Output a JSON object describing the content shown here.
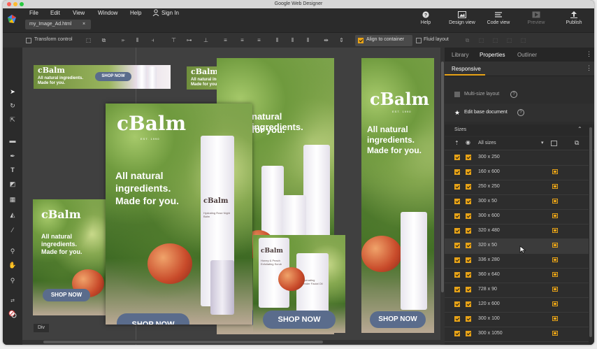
{
  "window": {
    "title": "Google Web Designer"
  },
  "menu": {
    "items": [
      "File",
      "Edit",
      "View",
      "Window",
      "Help"
    ],
    "sign_in": "Sign In"
  },
  "file_tab": {
    "name": "my_Image_Ad.html",
    "close": "×"
  },
  "top_buttons": {
    "help": "Help",
    "design_view": "Design view",
    "code_view": "Code view",
    "preview": "Preview",
    "publish": "Publish"
  },
  "toolbar": {
    "transform_control": "Transform control",
    "align_to_container": "Align to container",
    "fluid_layout": "Fluid layout"
  },
  "stage": {
    "element_label": "Div"
  },
  "ad": {
    "brand": "cBalm",
    "est": "EST. 1990",
    "tagline_lines": [
      "All natural",
      "ingredients.",
      "Made for you."
    ],
    "tagline_natural": "natural ingredients.",
    "tagline_foryou": "for you.",
    "cta": "SHOP NOW",
    "banner_tagline": "All natural ingredients. Made for you.",
    "product_brand": "cBalm",
    "product1": "Hydrating Rose Night Balm",
    "product2": "Honey & Peach Exfoliating Scrub",
    "product3": "Rejuvenating Lavender Facial Oil"
  },
  "panel": {
    "tabs": [
      "Library",
      "Properties",
      "Outliner"
    ],
    "subtab": "Responsive",
    "multi_size": "Multi-size layout",
    "edit_base": "Edit base document",
    "sizes_label": "Sizes",
    "all_sizes": "All sizes",
    "sizes": [
      "300 x 250",
      "160 x 600",
      "250 x 250",
      "300 x 50",
      "300 x 600",
      "320 x 480",
      "320 x 50",
      "336 x 280",
      "360 x 640",
      "728 x 90",
      "120 x 600",
      "300 x 100",
      "300 x 1050"
    ]
  },
  "colors": {
    "accent": "#e8a317",
    "button": "#5a6c8c",
    "panel_bg": "#2d2d2d",
    "stage_bg": "#404040"
  }
}
